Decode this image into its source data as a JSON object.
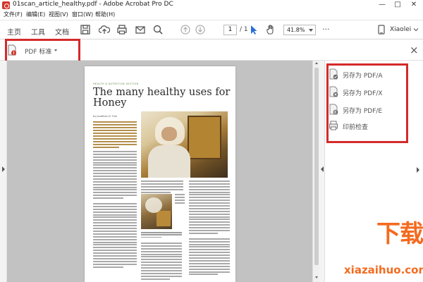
{
  "window": {
    "title": "01scan_article_healthy.pdf - Adobe Acrobat Pro DC",
    "minimize": "—",
    "maximize": "□",
    "close": "✕"
  },
  "menubar": {
    "items": [
      "文件(F)",
      "编辑(E)",
      "视图(V)",
      "窗口(W)",
      "帮助(H)"
    ]
  },
  "toolbar": {
    "tabs": [
      "主页",
      "工具",
      "文档"
    ],
    "page_current": "1",
    "page_total": "/ 1",
    "zoom": "41.8%",
    "more": "···",
    "user": "Xiaolei",
    "icons": [
      "save-icon",
      "upload-icon",
      "print-icon",
      "mail-icon",
      "search-icon",
      "page-up-icon",
      "page-down-icon",
      "select-arrow-icon",
      "hand-icon",
      "device-icon",
      "chevron-down-icon"
    ]
  },
  "std_bar": {
    "label": "PDF 标准",
    "close": "×"
  },
  "right_panel": {
    "items": [
      {
        "label": "另存为 PDF/A",
        "icon": "pdf-a-icon"
      },
      {
        "label": "另存为 PDF/X",
        "icon": "pdf-x-icon"
      },
      {
        "label": "另存为 PDF/E",
        "icon": "pdf-e-icon"
      },
      {
        "label": "印前检查",
        "icon": "preflight-icon"
      }
    ]
  },
  "document": {
    "section": "HEALTH & NUTRITION SECTION",
    "headline_1": "The many healthy uses for",
    "headline_2": "Honey",
    "byline": "by Jonathon D. Fulk"
  },
  "colors": {
    "highlight_red": "#d42a2a",
    "watermark_orange": "#f36b20",
    "doc_background": "#c2c2c2"
  },
  "watermark": {
    "brand": "下载火",
    "url": "xiazaihuo.com"
  }
}
